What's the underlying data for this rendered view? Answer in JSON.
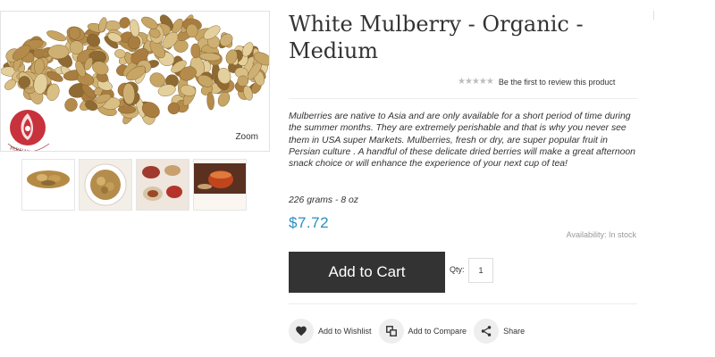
{
  "product": {
    "title": "White Mulberry - Organic - Medium",
    "rating_stars": "★★★★★",
    "review_link": "Be the first to review this product",
    "description": "Mulberries are native to Asia and are only available for a short period of time during the summer months. They are extremely perishable and that is why you never see them in USA super Markets. Mulberries, fresh or dry, are super popular fruit in Persian culture . A handful of these delicate dried berries will make a great afternoon snack choice or will enhance the experience of your next cup of tea!",
    "weight": "226 grams - 8 oz",
    "price": "$7.72",
    "availability": "Availability: In stock",
    "price_color": "#2a8fbd"
  },
  "gallery": {
    "zoom_label": "Zoom",
    "logo_text": "PERSIAN BASKET",
    "thumbnails": [
      "mulberry-pile-thumb",
      "mulberry-bowl-thumb",
      "tea-table-thumb",
      "tea-cup-thumb"
    ]
  },
  "cart": {
    "add_to_cart_label": "Add to Cart",
    "qty_label": "Qty:",
    "qty_value": "1"
  },
  "actions": {
    "wishlist_label": "Add to Wishlist",
    "compare_label": "Add to Compare",
    "share_label": "Share"
  },
  "icons": {
    "wishlist": "heart-icon",
    "compare": "compare-icon",
    "share": "share-icon"
  }
}
